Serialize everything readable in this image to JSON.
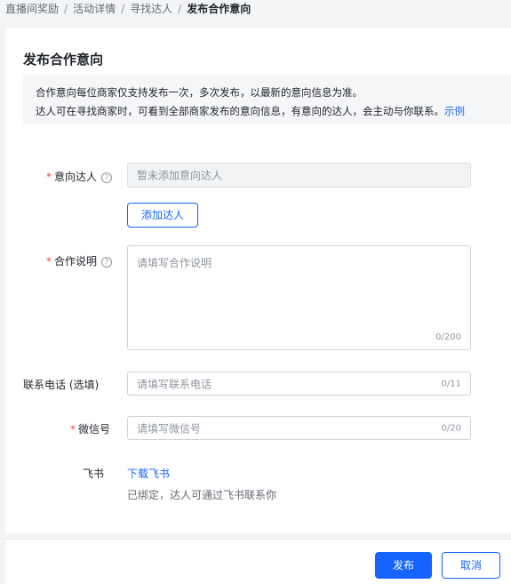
{
  "breadcrumb": {
    "items": [
      "直播间奖励",
      "活动详情",
      "寻找达人"
    ],
    "current": "发布合作意向",
    "separator": "/"
  },
  "card": {
    "title": "发布合作意向",
    "notice": {
      "line1": "合作意向每位商家仅支持发布一次，多次发布，以最新的意向信息为准。",
      "line2": "达人可在寻找商家时，可看到全部商家发布的意向信息，有意向的达人，会主动与你联系。",
      "link": "示例"
    }
  },
  "form": {
    "required_mark": "*",
    "help_icon": "?",
    "creator": {
      "label": "意向达人",
      "placeholder": "暂未添加意向达人",
      "add_button": "添加达人"
    },
    "description": {
      "label": "合作说明",
      "placeholder": "请填写合作说明",
      "counter": "0/200"
    },
    "phone": {
      "label": "联系电话 (选填)",
      "placeholder": "请填写联系电话",
      "counter": "0/11"
    },
    "wechat": {
      "label": "微信号",
      "placeholder": "请填写微信号",
      "counter": "0/20"
    },
    "feishu": {
      "label": "飞书",
      "link": "下载飞书",
      "desc": "已绑定，达人可通过飞书联系你"
    }
  },
  "footer": {
    "publish": "发布",
    "cancel": "取消"
  },
  "colors": {
    "accent": "#1664ff",
    "required": "#f54a45",
    "notice_bg": "#f5f6f8"
  }
}
